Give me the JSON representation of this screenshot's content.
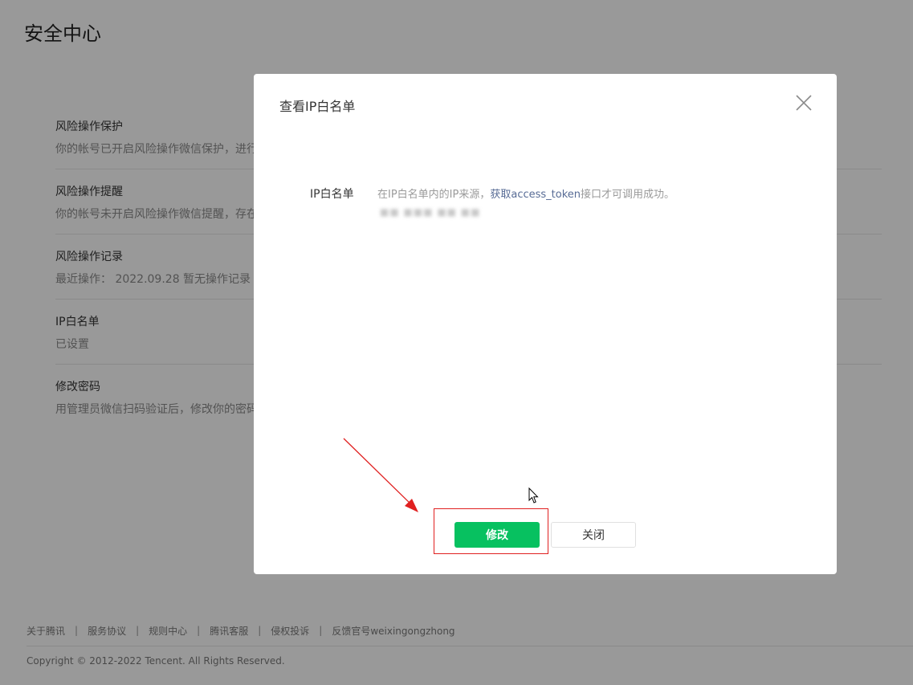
{
  "page": {
    "title": "安全中心"
  },
  "settings": [
    {
      "title": "风险操作保护",
      "desc": "你的帐号已开启风险操作微信保护，进行"
    },
    {
      "title": "风险操作提醒",
      "desc": "你的帐号未开启风险操作微信提醒，存在"
    },
    {
      "title": "风险操作记录",
      "desc": "最近操作：  2022.09.28    暂无操作记录"
    },
    {
      "title": "IP白名单",
      "desc": "已设置"
    },
    {
      "title": "修改密码",
      "desc": "用管理员微信扫码验证后，修改你的密码"
    }
  ],
  "footer": {
    "links": [
      "关于腾讯",
      "服务协议",
      "规则中心",
      "腾讯客服",
      "侵权投诉",
      "反馈官号weixingongzhong"
    ],
    "separator": "|",
    "copyright": "Copyright © 2012-2022 Tencent. All Rights Reserved."
  },
  "modal": {
    "title": "查看IP白名单",
    "field_label": "IP白名单",
    "desc_prefix": "在IP白名单内的IP来源，",
    "desc_link": "获取access_token",
    "desc_suffix": "接口才可调用成功。",
    "ip_value": "■■ ■■■ ■■ ■■",
    "modify_button": "修改",
    "close_button": "关闭"
  },
  "colors": {
    "primary_green": "#07c160",
    "link_blue": "#576b95",
    "annotation_red": "#e02020"
  },
  "icons": {
    "close": "close-icon",
    "arrow": "annotation-arrow",
    "cursor": "mouse-cursor"
  }
}
